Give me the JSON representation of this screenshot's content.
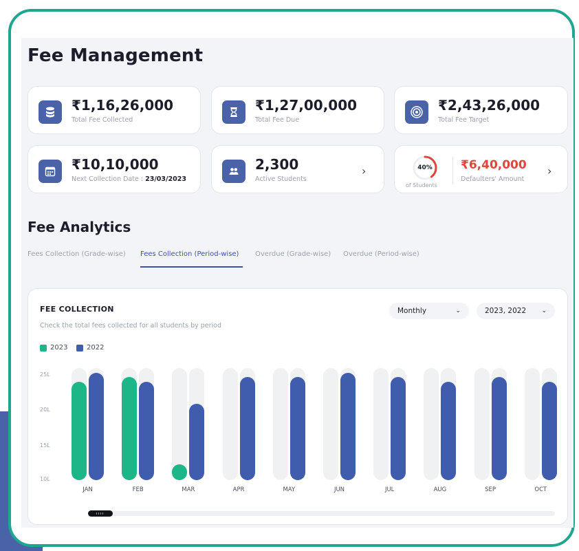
{
  "page": {
    "title": "Fee Management"
  },
  "stats": {
    "collected": {
      "value": "₹1,16,26,000",
      "label": "Total Fee Collected",
      "icon": "database-icon"
    },
    "due": {
      "value": "₹1,27,00,000",
      "label": "Total Fee Due",
      "icon": "hourglass-icon"
    },
    "target": {
      "value": "₹2,43,26,000",
      "label": "Total Fee Target",
      "icon": "target-icon"
    },
    "next": {
      "value": "₹10,10,000",
      "label": "Next Collection Date : ",
      "date": "23/03/2023",
      "icon": "calendar-icon"
    },
    "students": {
      "value": "2,300",
      "label": "Active Students",
      "icon": "users-icon"
    },
    "defaulters": {
      "percent": "40%",
      "percent_value": 0.4,
      "percent_caption": "of Students",
      "amount": "₹6,40,000",
      "amount_label": "Defaulters' Amount",
      "amount_color": "#e0453b"
    }
  },
  "analytics": {
    "title": "Fee Analytics",
    "tabs": [
      {
        "label": "Fees Collection (Grade-wise)",
        "active": false
      },
      {
        "label": "Fees Collection (Period-wise)",
        "active": true
      },
      {
        "label": "Overdue (Grade-wise)",
        "active": false
      },
      {
        "label": "Overdue (Period-wise)",
        "active": false
      }
    ],
    "card_title": "FEE COLLECTION",
    "card_subtitle": "Check the total fees collected for all students by period",
    "period_dropdown": "Monthly",
    "year_dropdown": "2023, 2022"
  },
  "colors": {
    "accent": "#3b51a3",
    "series_2023": "#1db689",
    "series_2022": "#3f5cad",
    "frame": "#1ea68f"
  },
  "chart_data": {
    "type": "bar",
    "categories": [
      "JAN",
      "FEB",
      "MAR",
      "APR",
      "MAY",
      "JUN",
      "JUL",
      "AUG",
      "SEP",
      "OCT"
    ],
    "series": [
      {
        "name": "2023",
        "values": [
          22,
          23,
          3.5,
          null,
          null,
          null,
          null,
          null,
          null,
          null
        ]
      },
      {
        "name": "2022",
        "values": [
          24,
          22,
          17,
          23,
          23,
          24,
          23,
          22,
          23,
          22
        ]
      }
    ],
    "y_ticks": [
      "25L",
      "20L",
      "15L",
      "10L"
    ],
    "ylim": [
      0,
      25
    ],
    "legend": "top-left"
  }
}
